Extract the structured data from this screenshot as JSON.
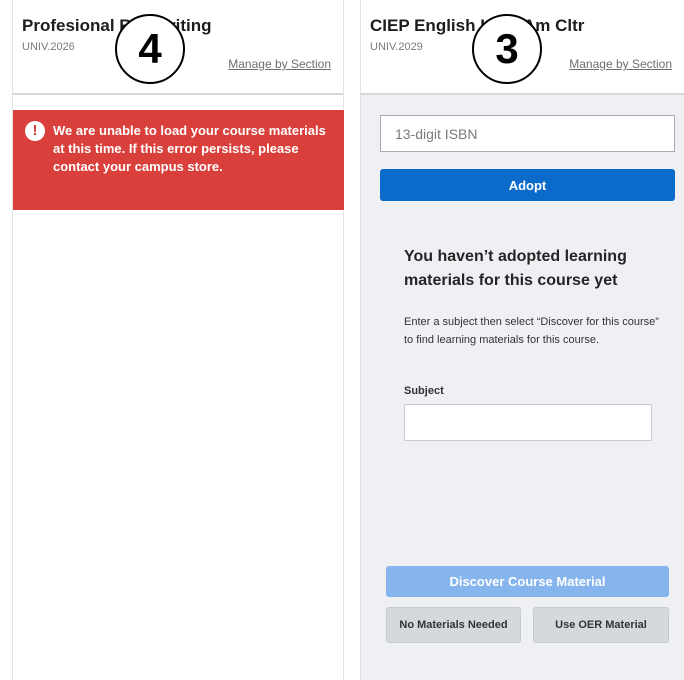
{
  "left_card": {
    "title": "Profesional R… Writing",
    "course_code": "UNIV.2026",
    "manage_link": "Manage by Section",
    "badge": "4",
    "error_message": "We are unable to load your course materials at this time. If this error persists, please contact your campus store.",
    "error_icon": "!"
  },
  "right_card": {
    "title": "CIEP English I… & Am Cltr",
    "course_code": "UNIV.2029",
    "manage_link": "Manage by Section",
    "badge": "3",
    "isbn_placeholder": "13-digit ISBN",
    "isbn_value": "",
    "adopt_label": "Adopt",
    "empty_heading": "You haven’t adopted learning materials for this course yet",
    "empty_description": "Enter a subject then select “Discover for this course” to find learning materials for this course.",
    "subject_label": "Subject",
    "subject_value": "",
    "discover_label": "Discover Course Material",
    "no_materials_label": "No Materials Needed",
    "oer_label": "Use OER Material"
  },
  "colors": {
    "error_bg": "#d9403b",
    "primary": "#0b6bcb",
    "primary_disabled": "#86b5ee",
    "secondary_bg": "#d5d9de"
  }
}
